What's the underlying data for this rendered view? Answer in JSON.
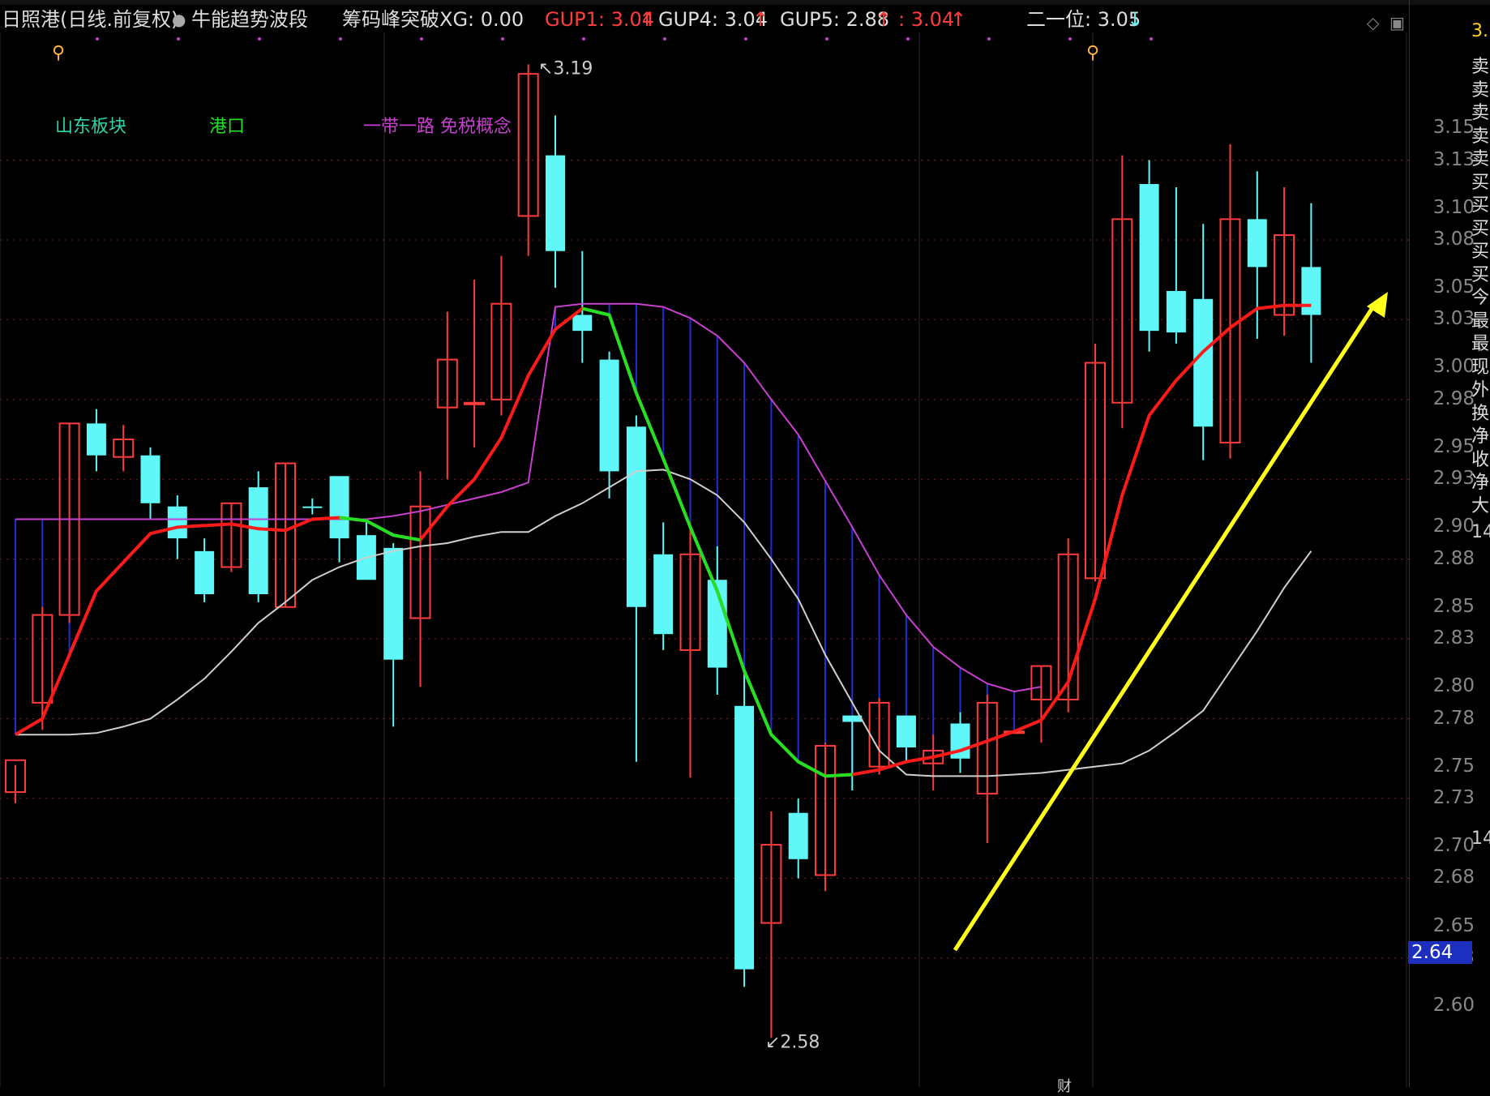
{
  "header": {
    "stock": "日照港(日线.前复权)",
    "indicator_icon": "check-circle-icon",
    "indicator": "牛能趋势波段",
    "xg_label": "筹码峰突破XG: 0.00",
    "gup1": "GUP1: 3.04",
    "gup4": "GUP4: 3.04",
    "gup5": "GUP5: 2.88",
    "extra": ": 3.04",
    "second": "二一位: 3.05"
  },
  "arrows": {
    "up": "↑",
    "down": "↓"
  },
  "sectors": [
    "山东板块",
    "港口",
    "一带一路 免税概念"
  ],
  "markers": {
    "high": "3.19",
    "low": "2.58",
    "side_number": "3.",
    "mid_number_a": "14",
    "mid_number_b": "14",
    "current": "2.64",
    "bottom_char": "财"
  },
  "side_labels": [
    "卖",
    "卖",
    "卖",
    "卖",
    "卖",
    "买",
    "买",
    "买",
    "买",
    "买",
    "今",
    "最",
    "最",
    "现",
    "外",
    "换",
    "净",
    "收",
    "净",
    "大"
  ],
  "colors": {
    "up": "#ff3b3b",
    "down": "#5ff7f7",
    "ma_red": "#ff1a1a",
    "ma_green": "#22e022",
    "ma_white": "#cfcfcf",
    "magenta": "#c93fd0",
    "blue": "#1f2fd8",
    "arrow": "#ffff1a",
    "grid": "#8a1a1a"
  },
  "icons": [
    "person-marker-icon",
    "diamond-icon",
    "window-icon"
  ],
  "chart_data": {
    "type": "candlestick",
    "ylim": [
      2.57,
      3.21
    ],
    "y_ticks": [
      3.15,
      3.13,
      3.1,
      3.08,
      3.05,
      3.03,
      3.0,
      2.98,
      2.95,
      2.93,
      2.9,
      2.88,
      2.85,
      2.83,
      2.8,
      2.78,
      2.75,
      2.73,
      2.7,
      2.68,
      2.65,
      2.63,
      2.6
    ],
    "candles": [
      {
        "o": 2.734,
        "h": 2.751,
        "l": 2.727,
        "c": 2.754
      },
      {
        "o": 2.79,
        "h": 2.85,
        "l": 2.773,
        "c": 2.845
      },
      {
        "o": 2.845,
        "h": 2.965,
        "l": 2.84,
        "c": 2.965
      },
      {
        "o": 2.965,
        "h": 2.974,
        "l": 2.935,
        "c": 2.945
      },
      {
        "o": 2.944,
        "h": 2.964,
        "l": 2.935,
        "c": 2.955
      },
      {
        "o": 2.945,
        "h": 2.95,
        "l": 2.905,
        "c": 2.915
      },
      {
        "o": 2.913,
        "h": 2.92,
        "l": 2.88,
        "c": 2.893
      },
      {
        "o": 2.885,
        "h": 2.893,
        "l": 2.853,
        "c": 2.858
      },
      {
        "o": 2.875,
        "h": 2.915,
        "l": 2.872,
        "c": 2.915
      },
      {
        "o": 2.925,
        "h": 2.935,
        "l": 2.853,
        "c": 2.858
      },
      {
        "o": 2.85,
        "h": 2.94,
        "l": 2.85,
        "c": 2.94
      },
      {
        "o": 2.913,
        "h": 2.918,
        "l": 2.908,
        "c": 2.912
      },
      {
        "o": 2.932,
        "h": 2.932,
        "l": 2.878,
        "c": 2.893
      },
      {
        "o": 2.895,
        "h": 2.905,
        "l": 2.87,
        "c": 2.867
      },
      {
        "o": 2.887,
        "h": 2.89,
        "l": 2.775,
        "c": 2.817
      },
      {
        "o": 2.843,
        "h": 2.935,
        "l": 2.8,
        "c": 2.913
      },
      {
        "o": 2.975,
        "h": 3.035,
        "l": 2.93,
        "c": 3.005
      },
      {
        "o": 2.978,
        "h": 3.055,
        "l": 2.95,
        "c": 2.978
      },
      {
        "o": 2.98,
        "h": 3.07,
        "l": 2.97,
        "c": 3.04
      },
      {
        "o": 3.095,
        "h": 3.19,
        "l": 3.07,
        "c": 3.184
      },
      {
        "o": 3.133,
        "h": 3.158,
        "l": 3.05,
        "c": 3.073
      },
      {
        "o": 3.033,
        "h": 3.073,
        "l": 3.003,
        "c": 3.023
      },
      {
        "o": 3.005,
        "h": 3.01,
        "l": 2.918,
        "c": 2.935
      },
      {
        "o": 2.963,
        "h": 2.97,
        "l": 2.753,
        "c": 2.85
      },
      {
        "o": 2.883,
        "h": 2.903,
        "l": 2.823,
        "c": 2.833
      },
      {
        "o": 2.823,
        "h": 2.903,
        "l": 2.743,
        "c": 2.883
      },
      {
        "o": 2.867,
        "h": 2.888,
        "l": 2.795,
        "c": 2.812
      },
      {
        "o": 2.788,
        "h": 2.81,
        "l": 2.612,
        "c": 2.623
      },
      {
        "o": 2.652,
        "h": 2.722,
        "l": 2.58,
        "c": 2.701
      },
      {
        "o": 2.721,
        "h": 2.73,
        "l": 2.68,
        "c": 2.692
      },
      {
        "o": 2.682,
        "h": 2.765,
        "l": 2.672,
        "c": 2.763
      },
      {
        "o": 2.782,
        "h": 2.782,
        "l": 2.735,
        "c": 2.778
      },
      {
        "o": 2.75,
        "h": 2.793,
        "l": 2.745,
        "c": 2.79
      },
      {
        "o": 2.782,
        "h": 2.782,
        "l": 2.752,
        "c": 2.762
      },
      {
        "o": 2.752,
        "h": 2.77,
        "l": 2.735,
        "c": 2.76
      },
      {
        "o": 2.777,
        "h": 2.784,
        "l": 2.746,
        "c": 2.755
      },
      {
        "o": 2.733,
        "h": 2.795,
        "l": 2.702,
        "c": 2.79
      },
      {
        "o": 2.772,
        "h": 2.773,
        "l": 2.771,
        "c": 2.772
      },
      {
        "o": 2.792,
        "h": 2.813,
        "l": 2.765,
        "c": 2.813
      },
      {
        "o": 2.792,
        "h": 2.893,
        "l": 2.784,
        "c": 2.883
      },
      {
        "o": 2.868,
        "h": 3.015,
        "l": 2.866,
        "c": 3.003
      },
      {
        "o": 2.978,
        "h": 3.133,
        "l": 2.962,
        "c": 3.093
      },
      {
        "o": 3.115,
        "h": 3.13,
        "l": 3.01,
        "c": 3.023
      },
      {
        "o": 3.048,
        "h": 3.113,
        "l": 3.015,
        "c": 3.022
      },
      {
        "o": 3.043,
        "h": 3.09,
        "l": 2.942,
        "c": 2.963
      },
      {
        "o": 2.953,
        "h": 3.14,
        "l": 2.943,
        "c": 3.093
      },
      {
        "o": 3.093,
        "h": 3.123,
        "l": 3.018,
        "c": 3.063
      },
      {
        "o": 3.033,
        "h": 3.113,
        "l": 3.02,
        "c": 3.083
      },
      {
        "o": 3.063,
        "h": 3.103,
        "l": 3.003,
        "c": 3.033
      }
    ],
    "ma_red": [
      2.77,
      2.78,
      2.82,
      2.86,
      2.878,
      2.896,
      2.9,
      2.901,
      2.902,
      2.899,
      2.898,
      2.905,
      2.906,
      2.904,
      2.895,
      2.892,
      2.913,
      2.93,
      2.956,
      2.995,
      3.024,
      3.037,
      3.033,
      2.984,
      2.943,
      2.9,
      2.86,
      2.81,
      2.77,
      2.753,
      2.744,
      2.745,
      2.748,
      2.753,
      2.756,
      2.76,
      2.766,
      2.772,
      2.779,
      2.803,
      2.855,
      2.92,
      2.97,
      2.992,
      3.01,
      3.025,
      3.037,
      3.039,
      3.039
    ],
    "ma_green_idx": [
      [
        12,
        15
      ],
      [
        21,
        31
      ]
    ],
    "ma_white": [
      2.77,
      2.77,
      2.77,
      2.771,
      2.775,
      2.78,
      2.792,
      2.805,
      2.822,
      2.84,
      2.853,
      2.867,
      2.875,
      2.881,
      2.885,
      2.888,
      2.89,
      2.894,
      2.897,
      2.897,
      2.907,
      2.915,
      2.925,
      2.935,
      2.936,
      2.93,
      2.92,
      2.903,
      2.88,
      2.855,
      2.82,
      2.79,
      2.76,
      2.745,
      2.744,
      2.744,
      2.744,
      2.745,
      2.746,
      2.748,
      2.75,
      2.752,
      2.76,
      2.772,
      2.785,
      2.81,
      2.835,
      2.862,
      2.885
    ],
    "ma_magenta": [
      2.905,
      2.905,
      2.905,
      2.905,
      2.905,
      2.905,
      2.905,
      2.905,
      2.905,
      2.905,
      2.905,
      2.905,
      2.905,
      2.905,
      2.907,
      2.91,
      2.914,
      2.918,
      2.922,
      2.928,
      3.038,
      3.04,
      3.04,
      3.04,
      3.038,
      3.031,
      3.02,
      3.003,
      2.98,
      2.958,
      2.929,
      2.9,
      2.87,
      2.845,
      2.825,
      2.812,
      2.802,
      2.797,
      2.8
    ],
    "blue_fill_range": [
      [
        0,
        2
      ],
      [
        20,
        38
      ]
    ]
  }
}
